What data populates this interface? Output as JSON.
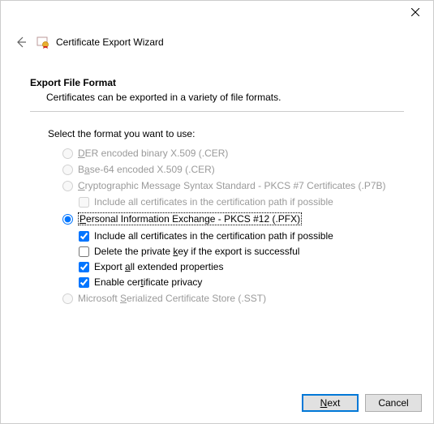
{
  "window": {
    "title": "Certificate Export Wizard"
  },
  "section": {
    "title": "Export File Format",
    "subtitle": "Certificates can be exported in a variety of file formats."
  },
  "prompt": "Select the format you want to use:",
  "options": {
    "der": "DER encoded binary X.509 (.CER)",
    "base64": "Base-64 encoded X.509 (.CER)",
    "pkcs7": "Cryptographic Message Syntax Standard - PKCS #7 Certificates (.P7B)",
    "pkcs7_include": "Include all certificates in the certification path if possible",
    "pfx": "Personal Information Exchange - PKCS #12 (.PFX)",
    "pfx_include": "Include all certificates in the certification path if possible",
    "pfx_delete": "Delete the private key if the export is successful",
    "pfx_ext": "Export all extended properties",
    "pfx_privacy": "Enable certificate privacy",
    "sst": "Microsoft Serialized Certificate Store (.SST)"
  },
  "selected": "pfx",
  "checks": {
    "pfx_include": true,
    "pfx_delete": false,
    "pfx_ext": true,
    "pfx_privacy": true
  },
  "buttons": {
    "next": "Next",
    "cancel": "Cancel"
  }
}
